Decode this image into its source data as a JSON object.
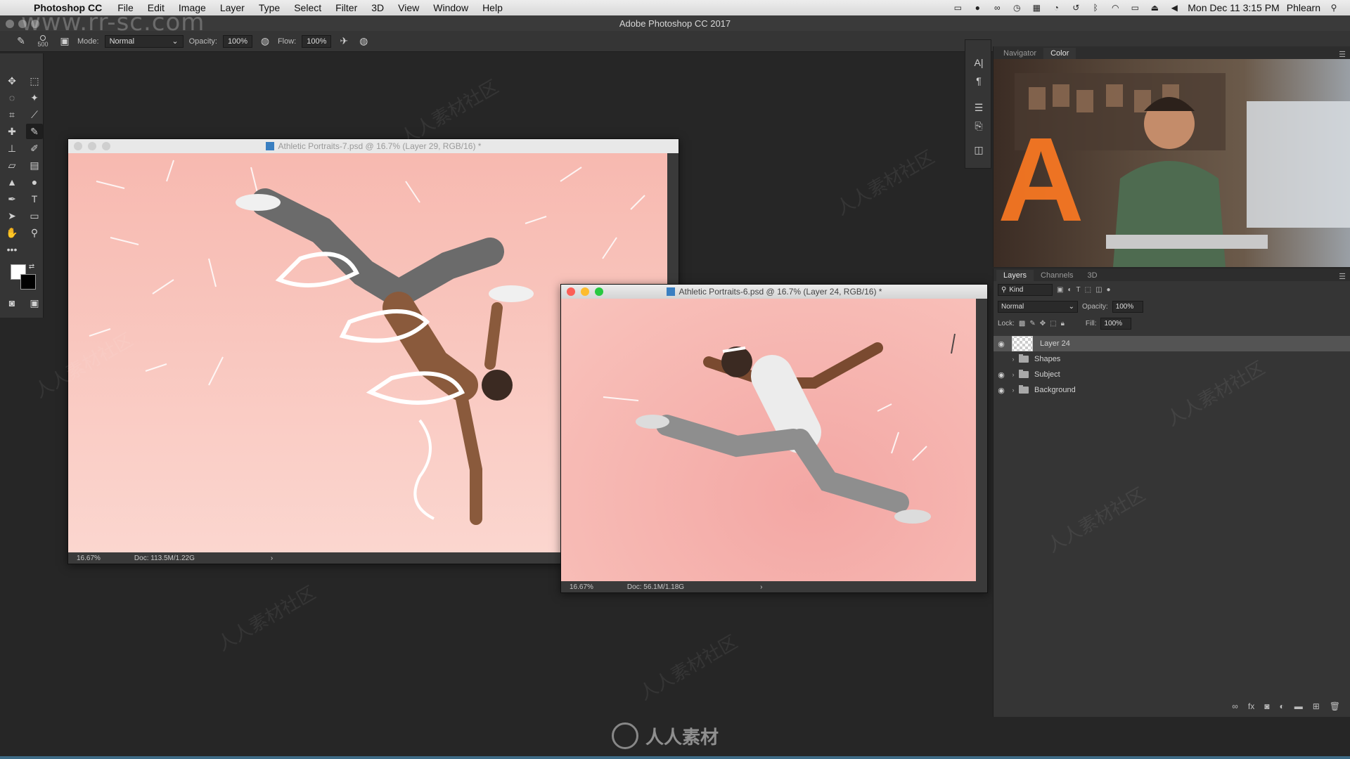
{
  "menubar": {
    "app_name": "Photoshop CC",
    "items": [
      "File",
      "Edit",
      "Image",
      "Layer",
      "Type",
      "Select",
      "Filter",
      "3D",
      "View",
      "Window",
      "Help"
    ],
    "clock": "Mon Dec 11  3:15 PM",
    "user": "Phlearn"
  },
  "window": {
    "title": "Adobe Photoshop CC 2017"
  },
  "options": {
    "brush_size": "500",
    "mode_label": "Mode:",
    "mode_value": "Normal",
    "opacity_label": "Opacity:",
    "opacity_value": "100%",
    "flow_label": "Flow:",
    "flow_value": "100%"
  },
  "documents": [
    {
      "title": "Athletic Portraits-7.psd @ 16.7% (Layer 29, RGB/16) *",
      "zoom": "16.67%",
      "doc_size": "Doc: 113.5M/1.22G"
    },
    {
      "title": "Athletic Portraits-6.psd @ 16.7% (Layer 24, RGB/16) *",
      "zoom": "16.67%",
      "doc_size": "Doc: 56.1M/1.18G"
    }
  ],
  "nav_panel": {
    "tabs": [
      "Navigator",
      "Color"
    ],
    "active": "Color"
  },
  "layers_panel": {
    "tabs": [
      "Layers",
      "Channels",
      "3D"
    ],
    "filter_kind": "Kind",
    "blend_mode": "Normal",
    "opacity_label": "Opacity:",
    "opacity_value": "100%",
    "lock_label": "Lock:",
    "fill_label": "Fill:",
    "fill_value": "100%",
    "layers": [
      {
        "name": "Layer 24",
        "type": "layer",
        "visible": true,
        "selected": true
      },
      {
        "name": "Shapes",
        "type": "group",
        "visible": false,
        "selected": false
      },
      {
        "name": "Subject",
        "type": "group",
        "visible": true,
        "selected": false
      },
      {
        "name": "Background",
        "type": "group",
        "visible": true,
        "selected": false
      }
    ]
  },
  "watermarks": {
    "url": "www.rr-sc.com",
    "logo_text": "人人素材",
    "tile_text": "人人素材社区"
  },
  "colors": {
    "canvas_pink": "#f6b7ae",
    "panel_bg": "#353535",
    "app_bg": "#262626"
  }
}
